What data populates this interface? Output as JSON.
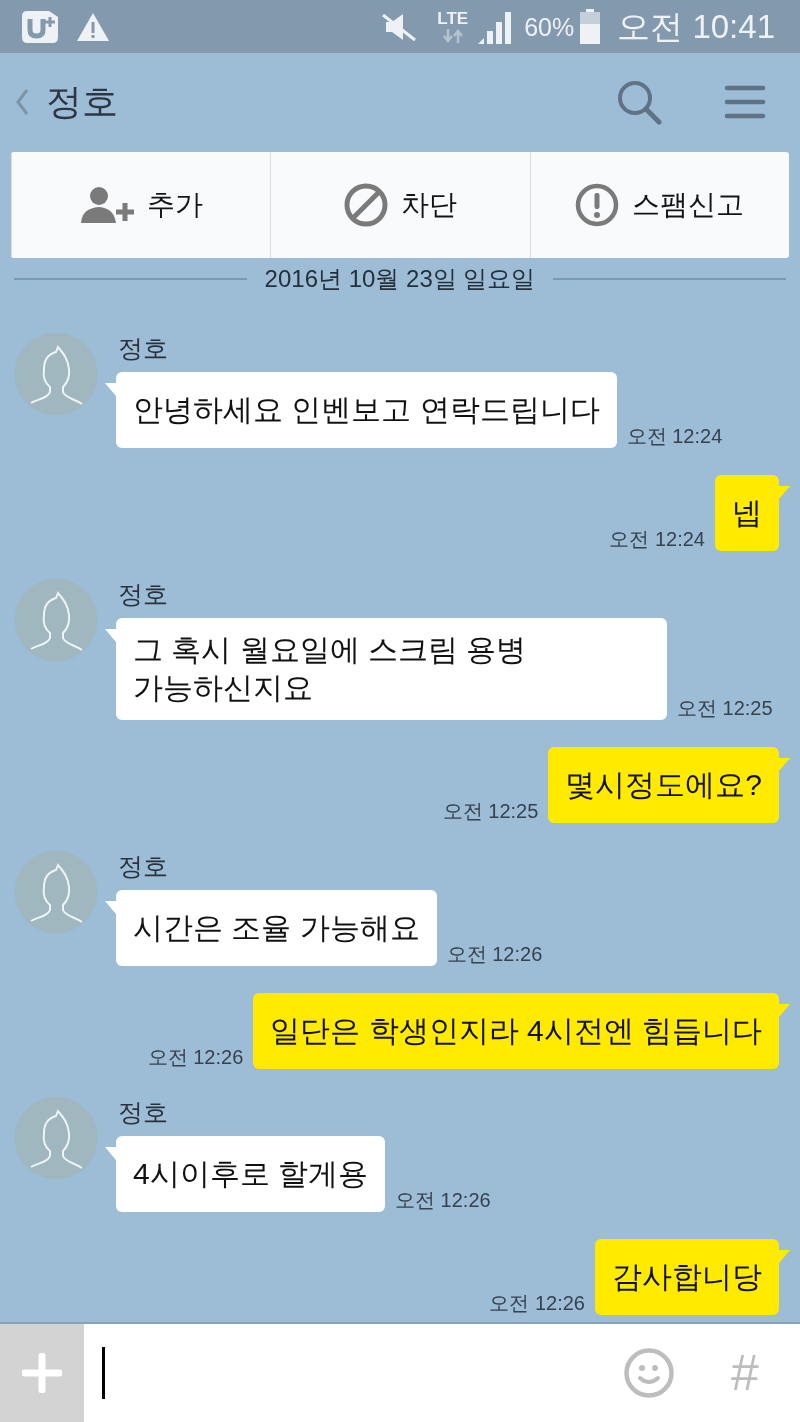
{
  "status_bar": {
    "network": "LTE",
    "battery": "60%",
    "time": "오전 10:41"
  },
  "header": {
    "title": "정호"
  },
  "actions": [
    {
      "kind": "add",
      "label": "추가"
    },
    {
      "kind": "block",
      "label": "차단"
    },
    {
      "kind": "report",
      "label": "스팸신고"
    }
  ],
  "date_divider": "2016년 10월 23일 일요일",
  "messages": [
    {
      "kind": "received",
      "sender": "정호",
      "text": "안녕하세요 인벤보고 연락드립니다",
      "time": "오전 12:24"
    },
    {
      "kind": "sent",
      "text": "넵",
      "time": "오전 12:24"
    },
    {
      "kind": "received",
      "sender": "정호",
      "text": "그 혹시 월요일에 스크림 용병 가능하신지요",
      "time": "오전 12:25"
    },
    {
      "kind": "sent",
      "text": "몇시정도에요?",
      "time": "오전 12:25"
    },
    {
      "kind": "received",
      "sender": "정호",
      "text": "시간은 조율 가능해요",
      "time": "오전 12:26"
    },
    {
      "kind": "sent",
      "text": "일단은 학생인지라 4시전엔 힘듭니다",
      "time": "오전 12:26"
    },
    {
      "kind": "received",
      "sender": "정호",
      "text": "4시이후로 할게용",
      "time": "오전 12:26"
    },
    {
      "kind": "sent",
      "text": "감사합니당",
      "time": "오전 12:26"
    }
  ],
  "composer": {
    "focused": true,
    "hashtag_button": "#"
  }
}
